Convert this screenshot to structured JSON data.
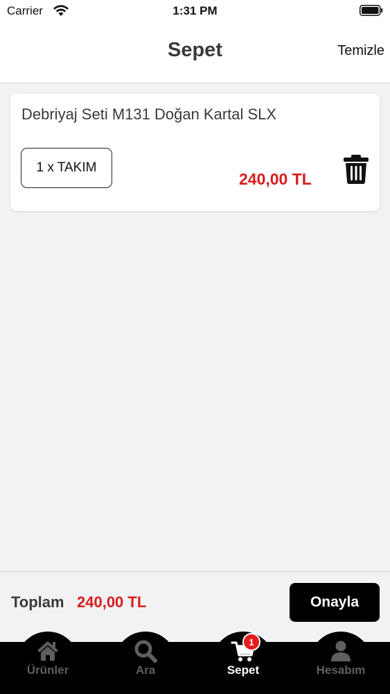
{
  "status_bar": {
    "carrier": "Carrier",
    "time": "1:31 PM",
    "icons": [
      "wifi-icon",
      "battery-icon"
    ]
  },
  "nav": {
    "title": "Sepet",
    "clear_label": "Temizle"
  },
  "cart": {
    "items": [
      {
        "name": "Debriyaj Seti M131 Doğan Kartal SLX",
        "quantity": "1 x TAKIM",
        "price": "240,00 TL",
        "delete_icon": "trash-icon"
      }
    ]
  },
  "footer": {
    "total_label": "Toplam",
    "total_value": "240,00 TL",
    "confirm_label": "Onayla"
  },
  "tabs": [
    {
      "label": "Ürünler",
      "icon": "home-icon",
      "active": false
    },
    {
      "label": "Ara",
      "icon": "search-icon",
      "active": false
    },
    {
      "label": "Sepet",
      "icon": "cart-icon",
      "active": true,
      "badge": "1"
    },
    {
      "label": "Hesabım",
      "icon": "user-icon",
      "active": false
    }
  ],
  "colors": {
    "accent_red": "#d81d1d",
    "tab_bar": "#000000",
    "inactive_icon": "#5f5f5f",
    "background": "#f2f2f4"
  }
}
